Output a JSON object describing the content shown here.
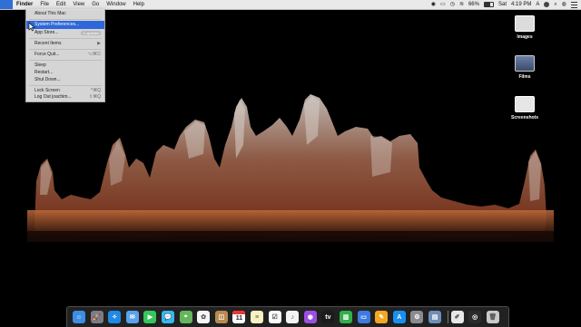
{
  "menubar": {
    "apple_icon": "apple-logo-icon",
    "items": [
      "Finder",
      "File",
      "Edit",
      "View",
      "Go",
      "Window",
      "Help"
    ],
    "battery_percent": "66%",
    "day": "Sat",
    "time": "4:19 PM",
    "input_source": "A",
    "status_icons": [
      "screen-recording-icon",
      "display-icon",
      "timemachine-icon",
      "wifi-icon",
      "battery-icon",
      "avatar-icon",
      "search-icon",
      "siri-icon",
      "notification-center-icon"
    ]
  },
  "apple_menu": {
    "about": "About This Mac",
    "system_prefs": "System Preferences...",
    "app_store": "App Store...",
    "app_store_badge": "4 updates",
    "recent_items": "Recent Items",
    "force_quit": "Force Quit...",
    "force_quit_shortcut": "⌥⌘⎋",
    "sleep": "Sleep",
    "restart": "Restart...",
    "shut_down": "Shut Down...",
    "lock_screen": "Lock Screen",
    "lock_shortcut": "^⌘Q",
    "log_out": "Log Out joachim...",
    "log_out_shortcut": "⇧⌘Q",
    "submenu_arrow": "▶"
  },
  "desktop": {
    "icons": [
      {
        "label": "Images",
        "icon": "folder-icon",
        "color": "#dcdcdc"
      },
      {
        "label": "Films",
        "icon": "film-icon",
        "color": "#7a8fb5"
      },
      {
        "label": "Screenshots",
        "icon": "screenshot-icon",
        "color": "#e6e6e6"
      }
    ]
  },
  "dock": {
    "apps": [
      {
        "name": "finder-icon",
        "color": "#3d8de4",
        "glyph": "☺"
      },
      {
        "name": "launchpad-icon",
        "color": "#7c7c84",
        "glyph": "🚀"
      },
      {
        "name": "safari-icon",
        "color": "#1f89e5",
        "glyph": "✧"
      },
      {
        "name": "mail-icon",
        "color": "#5aa2ec",
        "glyph": "✉"
      },
      {
        "name": "facetime-icon",
        "color": "#34c759",
        "glyph": "▶"
      },
      {
        "name": "messages-icon",
        "color": "#34b8f5",
        "glyph": "💬"
      },
      {
        "name": "maps-icon",
        "color": "#65b55a",
        "glyph": "⌖"
      },
      {
        "name": "photos-icon",
        "color": "#f6f6f6",
        "glyph": "✿"
      },
      {
        "name": "contacts-icon",
        "color": "#b98a4f",
        "glyph": "◫"
      },
      {
        "name": "calendar-icon",
        "color": "#ffffff",
        "glyph": "11"
      },
      {
        "name": "notes-icon",
        "color": "#f7f2c0",
        "glyph": "≡"
      },
      {
        "name": "reminders-icon",
        "color": "#fafafa",
        "glyph": "☑"
      },
      {
        "name": "music-icon",
        "color": "#f3f3f3",
        "glyph": "♪"
      },
      {
        "name": "podcasts-icon",
        "color": "#9c4fe0",
        "glyph": "◉"
      },
      {
        "name": "tv-icon",
        "color": "#1b1b1b",
        "glyph": "tv"
      },
      {
        "name": "numbers-icon",
        "color": "#31b04a",
        "glyph": "▥"
      },
      {
        "name": "keynote-icon",
        "color": "#3d7be0",
        "glyph": "▭"
      },
      {
        "name": "pages-icon",
        "color": "#f5a623",
        "glyph": "✎"
      },
      {
        "name": "app-store-icon",
        "color": "#1a8ff0",
        "glyph": "A"
      },
      {
        "name": "system-preferences-icon",
        "color": "#8a8a8f",
        "glyph": "⚙"
      },
      {
        "name": "preview-icon",
        "color": "#6d8fb8",
        "glyph": "▤"
      },
      {
        "name": "textedit-icon",
        "color": "#e7e7e7",
        "glyph": "✐"
      },
      {
        "name": "obs-icon",
        "color": "#2b2b2b",
        "glyph": "◎"
      },
      {
        "name": "trash-icon",
        "color": "#c9c9c9",
        "glyph": "🗑"
      }
    ]
  },
  "colors": {
    "menu_highlight": "#2d67d9",
    "rock_light": "#c9c2bd",
    "rock_rust": "#b0532c"
  }
}
